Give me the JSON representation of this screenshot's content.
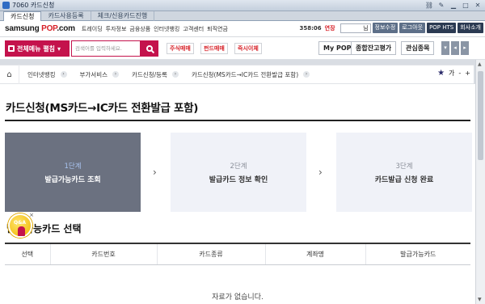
{
  "window": {
    "title": "7060 카드신청"
  },
  "tabs": [
    {
      "label": "카드신청",
      "active": true
    },
    {
      "label": "카드사용등록",
      "active": false
    },
    {
      "label": "체크/신용카드진행",
      "active": false
    }
  ],
  "header": {
    "logo_prefix": "samsung ",
    "logo_brand": "POP",
    "logo_suffix": ".com",
    "nav": [
      "트레이딩",
      "투자정보",
      "금융상품",
      "인터넷뱅킹",
      "고객센터",
      "퇴직연금"
    ],
    "time": "358:06",
    "extend_label": "연장",
    "user_field": "님",
    "buttons": [
      "정보수정",
      "로그아웃",
      "POP HTS",
      "회사소개"
    ]
  },
  "search": {
    "allmenu_label": "전체메뉴 펼침",
    "placeholder": "검색어를 입력하세요."
  },
  "quick": [
    "주식매매",
    "펀드매매",
    "즉시이체"
  ],
  "top_pills": [
    "My POP",
    "종합잔고평가",
    "관심종목"
  ],
  "breadcrumb": {
    "items": [
      "인터넷뱅킹",
      "부가서비스",
      "카드신청/등록",
      "카드신청(MS카드→IC카드 전환발급 포함)"
    ],
    "font_minus": "가",
    "font_minus2": "-",
    "font_plus": "+"
  },
  "page": {
    "title": "카드신청(MS카드→IC카드 전환발급 포함)"
  },
  "steps": [
    {
      "no": "1단계",
      "name": "발급가능카드 조회",
      "active": true
    },
    {
      "no": "2단계",
      "name": "발급카드 정보 확인",
      "active": false
    },
    {
      "no": "3단계",
      "name": "카드발급 신청 완료",
      "active": false
    }
  ],
  "section": {
    "title": "발급가능카드 선택",
    "qna_label": "Q&A",
    "columns": [
      "선택",
      "카드번호",
      "카드종류",
      "계좌명",
      "발급가능카드"
    ],
    "empty_text": "자료가 없습니다."
  },
  "colors": {
    "accent": "#c4124c",
    "step_active": "#6b7180",
    "step_idle": "#f0f2f8"
  }
}
